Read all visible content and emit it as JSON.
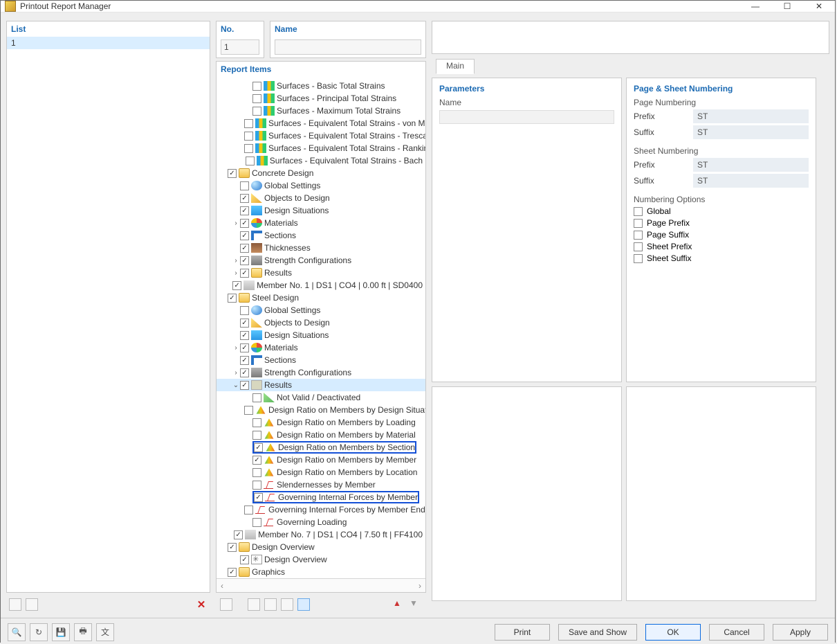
{
  "window": {
    "title": "Printout Report Manager"
  },
  "list": {
    "header": "List",
    "items": [
      "1"
    ]
  },
  "no": {
    "header": "No.",
    "value": "1"
  },
  "name": {
    "header": "Name",
    "value": ""
  },
  "reportItems": {
    "header": "Report Items",
    "nodes": [
      {
        "indent": 2,
        "checked": false,
        "icon": "ic-surf",
        "label": "Surfaces - Basic Total Strains"
      },
      {
        "indent": 2,
        "checked": false,
        "icon": "ic-surf",
        "label": "Surfaces - Principal Total Strains"
      },
      {
        "indent": 2,
        "checked": false,
        "icon": "ic-surf",
        "label": "Surfaces - Maximum Total Strains"
      },
      {
        "indent": 2,
        "checked": false,
        "icon": "ic-surf",
        "label": "Surfaces - Equivalent Total Strains - von Mises"
      },
      {
        "indent": 2,
        "checked": false,
        "icon": "ic-surf",
        "label": "Surfaces - Equivalent Total Strains - Tresca"
      },
      {
        "indent": 2,
        "checked": false,
        "icon": "ic-surf",
        "label": "Surfaces - Equivalent Total Strains - Rankine"
      },
      {
        "indent": 2,
        "checked": false,
        "icon": "ic-surf",
        "label": "Surfaces - Equivalent Total Strains - Bach"
      },
      {
        "indent": 0,
        "checked": true,
        "icon": "ic-folder",
        "label": "Concrete Design"
      },
      {
        "indent": 1,
        "checked": false,
        "icon": "ic-globe",
        "label": "Global Settings"
      },
      {
        "indent": 1,
        "checked": true,
        "icon": "ic-obj",
        "label": "Objects to Design"
      },
      {
        "indent": 1,
        "checked": true,
        "icon": "ic-dsit",
        "label": "Design Situations"
      },
      {
        "indent": 1,
        "checked": true,
        "icon": "ic-mat",
        "label": "Materials",
        "arrow": "›"
      },
      {
        "indent": 1,
        "checked": true,
        "icon": "ic-sect",
        "label": "Sections"
      },
      {
        "indent": 1,
        "checked": true,
        "icon": "ic-thk",
        "label": "Thicknesses"
      },
      {
        "indent": 1,
        "checked": true,
        "icon": "ic-str",
        "label": "Strength Configurations",
        "arrow": "›"
      },
      {
        "indent": 1,
        "checked": true,
        "icon": "ic-folder",
        "label": "Results",
        "arrow": "›"
      },
      {
        "indent": 1,
        "checked": true,
        "icon": "ic-mem",
        "label": "Member No. 1 | DS1 | CO4 | 0.00 ft | SD0400"
      },
      {
        "indent": 0,
        "checked": true,
        "icon": "ic-folder",
        "label": "Steel Design"
      },
      {
        "indent": 1,
        "checked": false,
        "icon": "ic-globe",
        "label": "Global Settings"
      },
      {
        "indent": 1,
        "checked": true,
        "icon": "ic-obj",
        "label": "Objects to Design"
      },
      {
        "indent": 1,
        "checked": true,
        "icon": "ic-dsit",
        "label": "Design Situations"
      },
      {
        "indent": 1,
        "checked": true,
        "icon": "ic-mat",
        "label": "Materials",
        "arrow": "›"
      },
      {
        "indent": 1,
        "checked": true,
        "icon": "ic-sect",
        "label": "Sections"
      },
      {
        "indent": 1,
        "checked": true,
        "icon": "ic-str",
        "label": "Strength Configurations",
        "arrow": "›"
      },
      {
        "indent": 1,
        "checked": true,
        "icon": "ic-res",
        "label": "Results",
        "arrow": "⌄",
        "selected": true
      },
      {
        "indent": 2,
        "checked": false,
        "icon": "ic-nv",
        "label": "Not Valid / Deactivated"
      },
      {
        "indent": 2,
        "checked": false,
        "icon": "ic-dr",
        "label": "Design Ratio on Members by Design Situation"
      },
      {
        "indent": 2,
        "checked": false,
        "icon": "ic-dr",
        "label": "Design Ratio on Members by Loading"
      },
      {
        "indent": 2,
        "checked": false,
        "icon": "ic-dr",
        "label": "Design Ratio on Members by Material"
      },
      {
        "indent": 2,
        "checked": true,
        "icon": "ic-dr",
        "label": "Design Ratio on Members by Section",
        "highlight": true
      },
      {
        "indent": 2,
        "checked": true,
        "icon": "ic-dr",
        "label": "Design Ratio on Members by Member"
      },
      {
        "indent": 2,
        "checked": false,
        "icon": "ic-dr",
        "label": "Design Ratio on Members by Location"
      },
      {
        "indent": 2,
        "checked": false,
        "icon": "ic-gf",
        "label": "Slendernesses by Member"
      },
      {
        "indent": 2,
        "checked": true,
        "icon": "ic-gf",
        "label": "Governing Internal Forces by Member",
        "highlight": true
      },
      {
        "indent": 2,
        "checked": false,
        "icon": "ic-gf",
        "label": "Governing Internal Forces by Member End"
      },
      {
        "indent": 2,
        "checked": false,
        "icon": "ic-gf",
        "label": "Governing Loading"
      },
      {
        "indent": 1,
        "checked": true,
        "icon": "ic-mem",
        "label": "Member No. 7 | DS1 | CO4 | 7.50 ft | FF4100"
      },
      {
        "indent": 0,
        "checked": true,
        "icon": "ic-folder",
        "label": "Design Overview"
      },
      {
        "indent": 1,
        "checked": true,
        "icon": "ic-ov",
        "label": "Design Overview"
      },
      {
        "indent": 0,
        "checked": true,
        "icon": "ic-folder",
        "label": "Graphics"
      }
    ]
  },
  "tabs": {
    "main": "Main"
  },
  "parameters": {
    "header": "Parameters",
    "name_label": "Name"
  },
  "numbering": {
    "header": "Page & Sheet Numbering",
    "page_section": "Page Numbering",
    "sheet_section": "Sheet Numbering",
    "prefix_label": "Prefix",
    "suffix_label": "Suffix",
    "page_prefix": "ST",
    "page_suffix": "ST",
    "sheet_prefix": "ST",
    "sheet_suffix": "ST",
    "options_header": "Numbering Options",
    "options": [
      "Global",
      "Page Prefix",
      "Page Suffix",
      "Sheet Prefix",
      "Sheet Suffix"
    ]
  },
  "buttons": {
    "print": "Print",
    "save_show": "Save and Show",
    "ok": "OK",
    "cancel": "Cancel",
    "apply": "Apply"
  }
}
